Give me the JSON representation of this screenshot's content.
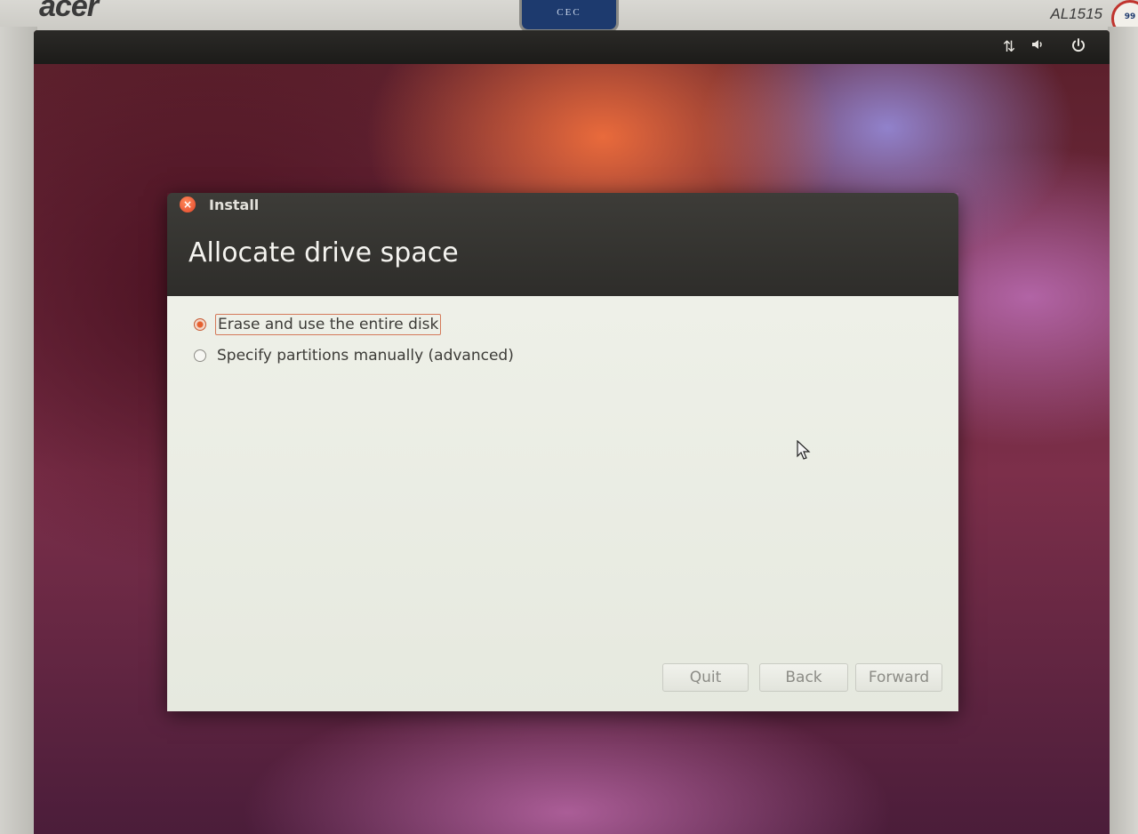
{
  "monitor": {
    "brand": "acer",
    "model": "AL1515",
    "sticker": "CEC",
    "badge": "99"
  },
  "panel": {
    "icons": [
      "network-icon",
      "volume-icon",
      "power-icon"
    ]
  },
  "window": {
    "title": "Install",
    "heading": "Allocate drive space",
    "options": [
      {
        "label": "Erase and use the entire disk",
        "selected": true
      },
      {
        "label": "Specify partitions manually (advanced)",
        "selected": false
      }
    ],
    "buttons": {
      "quit": "Quit",
      "back": "Back",
      "forward": "Forward"
    }
  },
  "colors": {
    "accent": "#e5602f",
    "titlebar": "#3d3c38",
    "content_bg": "#eef0e8"
  }
}
